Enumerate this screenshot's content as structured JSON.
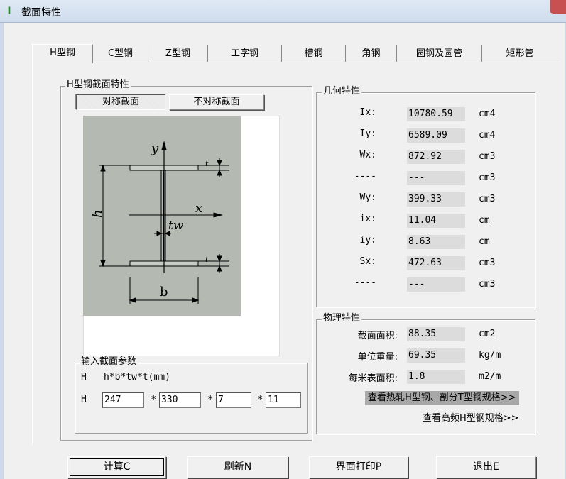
{
  "window": {
    "title": "截面特性"
  },
  "tabs": [
    "H型钢",
    "C型钢",
    "Z型钢",
    "工字钢",
    "槽钢",
    "角钢",
    "圆钢及圆管",
    "矩形管"
  ],
  "section_group": {
    "label": "H型钢截面特性",
    "symmetric": "对称截面",
    "asymmetric": "不对称截面"
  },
  "diagram": {
    "y": "y",
    "x": "x",
    "h": "h",
    "b": "b",
    "tw": "tw",
    "t": "t"
  },
  "input_group": {
    "label": "输入截面参数",
    "formula_prefix": "H",
    "formula": "h*b*tw*t(mm)",
    "row_prefix": "H",
    "star": "*",
    "values": [
      "247",
      "330",
      "7",
      "11"
    ]
  },
  "geometry": {
    "label": "几何特性",
    "rows": [
      {
        "name": "Ix:",
        "value": "10780.59",
        "unit": "cm4"
      },
      {
        "name": "Iy:",
        "value": "6589.09",
        "unit": "cm4"
      },
      {
        "name": "Wx:",
        "value": "872.92",
        "unit": "cm3"
      },
      {
        "name": "----",
        "value": "---",
        "unit": "cm3"
      },
      {
        "name": "Wy:",
        "value": "399.33",
        "unit": "cm3"
      },
      {
        "name": "ix:",
        "value": "11.04",
        "unit": "cm"
      },
      {
        "name": "iy:",
        "value": "8.63",
        "unit": "cm"
      },
      {
        "name": "Sx:",
        "value": "472.63",
        "unit": "cm3"
      },
      {
        "name": "----",
        "value": "---",
        "unit": "cm3"
      }
    ]
  },
  "physical": {
    "label": "物理特性",
    "rows": [
      {
        "name": "截面面积:",
        "value": "88.35",
        "unit": "cm2"
      },
      {
        "name": "单位重量:",
        "value": "69.35",
        "unit": "kg/m"
      },
      {
        "name": "每米表面积:",
        "value": "1.8",
        "unit": "m2/m"
      }
    ],
    "link_hot": "查看热轧H型钢、剖分T型钢规格>>",
    "link_hf": "查看高频H型钢规格>>"
  },
  "buttons": {
    "calc": "计算C",
    "refresh": "刷新N",
    "print": "界面打印P",
    "exit": "退出E"
  }
}
